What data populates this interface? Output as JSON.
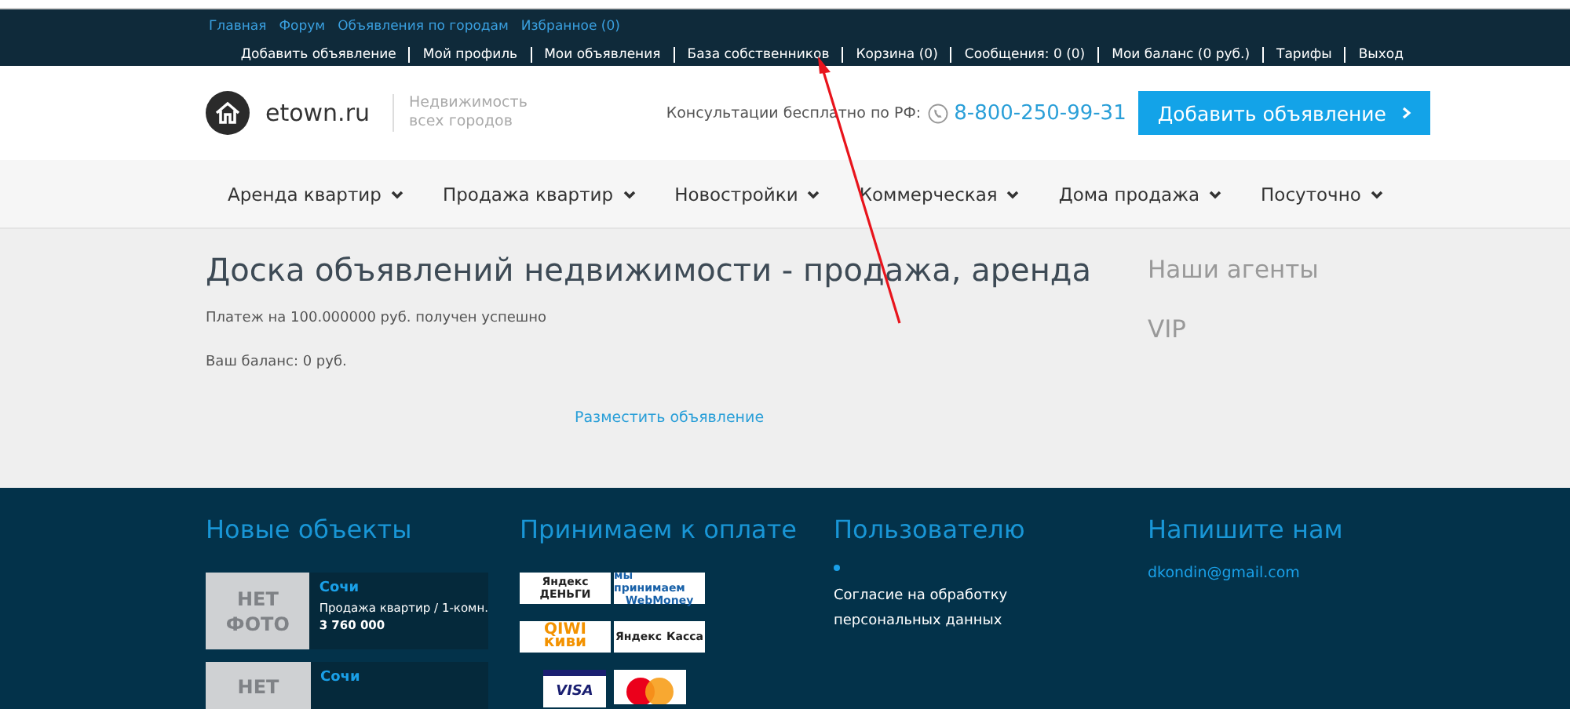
{
  "top_links": [
    "Главная",
    "Форум",
    "Объявления по городам",
    "Избранное (0)"
  ],
  "user_menu": [
    "Добавить объявление",
    "Мой профиль",
    "Мои объявления",
    "База собственников",
    "Корзина (0)",
    "Сообщения: 0 (0)",
    "Мои баланс (0 руб.)",
    "Тарифы",
    "Выход"
  ],
  "header": {
    "site_name": "etown.ru",
    "tagline": "Недвижимость всех городов",
    "consult_label": "Консультации бесплатно по РФ:",
    "phone": "8-800-250-99-31",
    "add_button": "Добавить объявление"
  },
  "nav": [
    "Аренда квартир",
    "Продажа квартир",
    "Новостройки",
    "Коммерческая",
    "Дома продажа",
    "Посуточно"
  ],
  "main": {
    "title": "Доска объявлений недвижимости - продажа, аренда",
    "payment_message": "Платеж на 100.000000 руб. получен успешно",
    "balance": "Ваш баланс: 0 руб.",
    "post_link": "Разместить объявление"
  },
  "sidebar": {
    "heading": "Наши агенты",
    "vip": "VIP"
  },
  "footer": {
    "new_objects": {
      "heading": "Новые объекты",
      "items": [
        {
          "no_photo": "НЕТ ФОТО",
          "city": "Сочи",
          "type": "Продажа квартир / 1-комн.",
          "price": "3 760 000"
        },
        {
          "no_photo": "НЕТ",
          "city": "Сочи"
        }
      ]
    },
    "payment": {
      "heading": "Принимаем к оплате",
      "logos": [
        {
          "kind": "yandex-money",
          "texts": [
            "Яндекс",
            "ДЕНЬГИ"
          ]
        },
        {
          "kind": "webmoney",
          "texts": [
            "мы принимаем",
            "WebMoney"
          ]
        },
        {
          "kind": "qiwi",
          "texts": [
            "QIWI",
            "киви"
          ]
        },
        {
          "kind": "yandex-kassa",
          "texts": [
            "Яндекс",
            "Касса"
          ]
        },
        {
          "kind": "visa",
          "texts": [
            "VISA"
          ]
        },
        {
          "kind": "mastercard"
        }
      ]
    },
    "user": {
      "heading": "Пользователю",
      "links": [
        "Согласие на обработку персональных данных"
      ]
    },
    "contact": {
      "heading": "Напишите нам",
      "email": "dkondin@gmail.com"
    }
  }
}
